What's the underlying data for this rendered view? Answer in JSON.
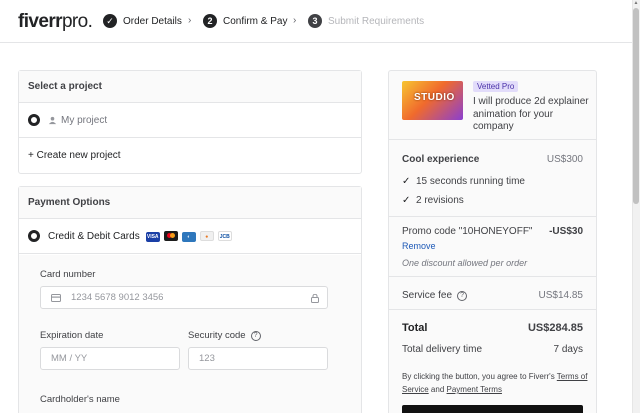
{
  "header": {
    "logo_main": "fiverr",
    "logo_suffix": "pro.",
    "steps": [
      {
        "number": "1",
        "label": "Order Details",
        "state": "done"
      },
      {
        "number": "2",
        "label": "Confirm & Pay",
        "state": "active"
      },
      {
        "number": "3",
        "label": "Submit Requirements",
        "state": "upcoming"
      }
    ],
    "separator": "›"
  },
  "project": {
    "heading": "Select a project",
    "option": "My project",
    "create_label": "+ Create new project"
  },
  "payment": {
    "heading": "Payment Options",
    "method_label": "Credit & Debit Cards",
    "cards": [
      "VISA",
      "MC",
      "AMEX",
      "DISC",
      "JCB"
    ],
    "card_number_label": "Card number",
    "card_number_placeholder": "1234 5678 9012 3456",
    "expiration_label": "Expiration date",
    "expiration_placeholder": "MM / YY",
    "security_label": "Security code",
    "security_placeholder": "123",
    "holder_label": "Cardholder's name"
  },
  "summary": {
    "badge": "Vetted Pro",
    "gig_title": "I will produce 2d explainer animation for your company",
    "package_name": "Cool experience",
    "package_price": "US$300",
    "features": [
      "15 seconds running time",
      "2 revisions"
    ],
    "promo_label": "Promo code \"10HONEYOFF\"",
    "promo_value": "-US$30",
    "promo_remove": "Remove",
    "promo_note": "One discount allowed per order",
    "service_fee_label": "Service fee",
    "service_fee_value": "US$14.85",
    "total_label": "Total",
    "total_value": "US$284.85",
    "delivery_label": "Total delivery time",
    "delivery_value": "7 days",
    "terms_prefix": "By clicking the button, you agree to Fiverr's",
    "terms_link": "Terms of Service",
    "terms_and": "and",
    "payment_terms_link": "Payment Terms"
  },
  "colors": {
    "accent": "#222325",
    "link": "#1d59b7",
    "badge_bg": "#e2dcfa",
    "badge_text": "#4a31a8"
  }
}
